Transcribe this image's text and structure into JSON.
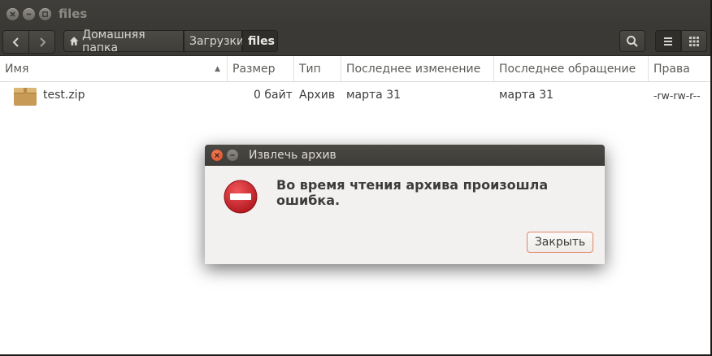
{
  "window": {
    "title": "files"
  },
  "toolbar": {
    "breadcrumbs": [
      "Домашняя папка",
      "Загрузки",
      "files"
    ]
  },
  "columns": [
    "Имя",
    "Размер",
    "Тип",
    "Последнее изменение",
    "Последнее обращение",
    "Права"
  ],
  "files": [
    {
      "name": "test.zip",
      "size": "0 байт",
      "type": "Архив",
      "modified": "марта 31",
      "accessed": "марта 31",
      "permissions": "-rw-rw-r--",
      "icon": "archive-icon"
    }
  ],
  "dialog": {
    "title": "Извлечь архив",
    "message": "Во время чтения архива произошла ошибка.",
    "close_button": "Закрыть",
    "icon": "error-icon"
  },
  "colors": {
    "accent": "#e0866a",
    "titlebar": "#3c3b37",
    "error_red": "#d0242a"
  }
}
